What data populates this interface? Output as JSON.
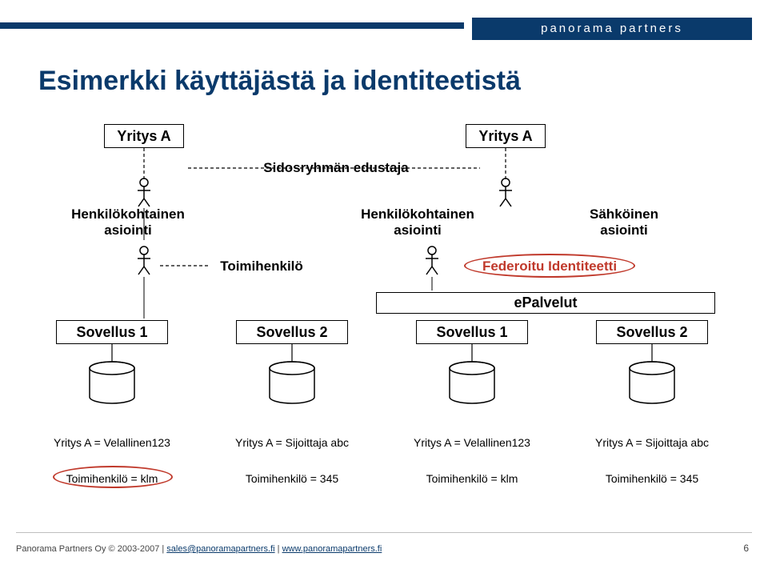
{
  "brand": "panorama partners",
  "title": "Esimerkki käyttäjästä ja identiteetistä",
  "boxes": {
    "yritysA1": "Yritys A",
    "yritysA2": "Yritys A",
    "sidosryhma": "Sidosryhmän edustaja"
  },
  "captions": {
    "henk1": "Henkilökohtainen\nasiointi",
    "henk2": "Henkilökohtainen\nasiointi",
    "sah": "Sähköinen\nasiointi",
    "toimi": "Toimihenkilö",
    "fed": "Federoitu Identiteetti",
    "epalvelut": "ePalvelut"
  },
  "sovellus": {
    "s1": "Sovellus 1",
    "s2": "Sovellus 2",
    "s3": "Sovellus 1",
    "s4": "Sovellus 2"
  },
  "cols": {
    "c1_top": "Yritys A = Velallinen123",
    "c1_bot": "Toimihenkilö = klm",
    "c2_top": "Yritys A = Sijoittaja abc",
    "c2_bot": "Toimihenkilö = 345",
    "c3_top": "Yritys A = Velallinen123",
    "c3_bot": "Toimihenkilö = klm",
    "c4_top": "Yritys A = Sijoittaja abc",
    "c4_bot": "Toimihenkilö = 345"
  },
  "footer": {
    "prefix": "Panorama Partners Oy © 2003-2007 | ",
    "email": "sales@panoramapartners.fi",
    "sep": " | ",
    "url": "www.panoramapartners.fi",
    "page": "6"
  }
}
